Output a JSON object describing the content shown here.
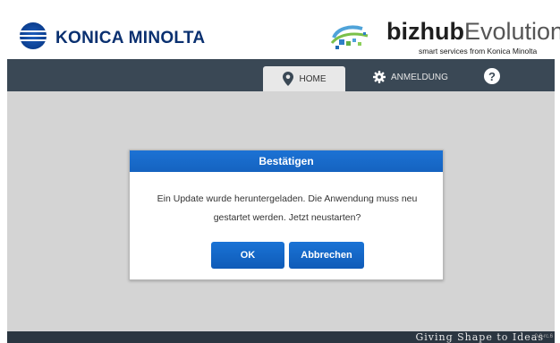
{
  "header": {
    "brand": "KONICA MINOLTA",
    "product_bold": "bizhub",
    "product_light": "Evolution",
    "tagline": "smart services from Konica Minolta"
  },
  "nav": {
    "home_label": "HOME",
    "login_label": "ANMELDUNG",
    "help_label": "?"
  },
  "dialog": {
    "title": "Bestätigen",
    "message": "Ein Update wurde heruntergeladen. Die Anwendung muss neu gestartet werden. Jetzt neustarten?",
    "ok_label": "OK",
    "cancel_label": "Abbrechen"
  },
  "footer": {
    "slogan": "Giving Shape to Ideas",
    "version": "0.0-rc.6"
  },
  "colors": {
    "navbar": "#3a4855",
    "dialog_accent": "#1563c0",
    "content_bg": "#d4d4d4",
    "brand_blue": "#0a3070"
  },
  "icons": {
    "home": "map-pin-icon",
    "login": "gear-icon",
    "help": "question-icon"
  }
}
